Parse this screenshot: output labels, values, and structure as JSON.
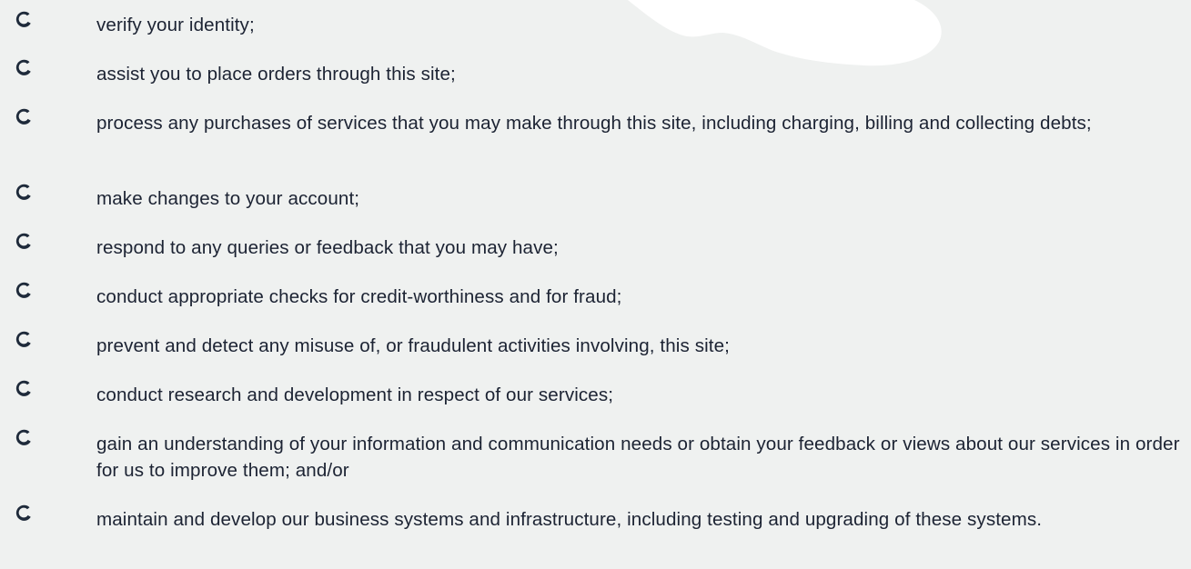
{
  "colors": {
    "background": "#eff1f0",
    "text": "#1c2333",
    "bullet": "#1e2a3a",
    "decoration": "#ffffff"
  },
  "bullet_icon": "crescent-c-icon",
  "list": {
    "items": [
      {
        "text": "verify your identity;"
      },
      {
        "text": "assist you to place orders through this site;"
      },
      {
        "text": "process any purchases of services that you may make through this site, including charging, billing and collecting debts;"
      },
      {
        "text": "make changes to your account;"
      },
      {
        "text": "respond to any queries or feedback that you may have;"
      },
      {
        "text": "conduct appropriate checks for credit-worthiness and for fraud;"
      },
      {
        "text": "prevent and detect any misuse of, or fraudulent activities involving, this site;"
      },
      {
        "text": "conduct research and development in respect of our services;"
      },
      {
        "text": "gain an understanding of your information and communication needs or obtain your feedback or views about our services in order for us to improve them; and/or"
      },
      {
        "text": "maintain and develop our business systems and infrastructure, including testing and upgrading of these systems."
      }
    ]
  }
}
